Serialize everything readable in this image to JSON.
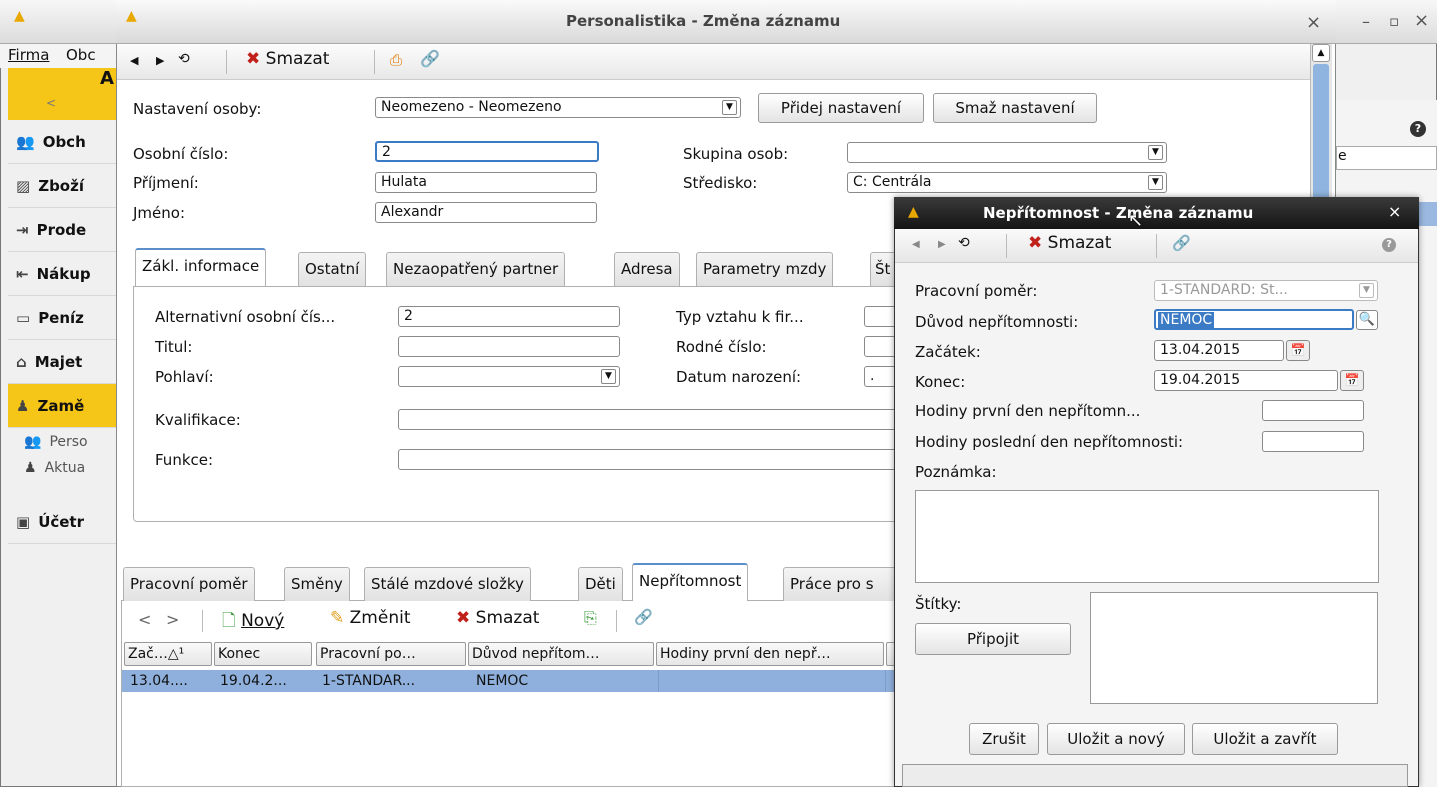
{
  "bg_window": {
    "menu": [
      "Firma",
      "Obc"
    ],
    "top_letter": "A",
    "collapse_arrow": "<",
    "nav": [
      {
        "icon": "people-icon",
        "label": "Obch"
      },
      {
        "icon": "box-icon",
        "label": "Zboží"
      },
      {
        "icon": "enter-icon",
        "label": "Prode"
      },
      {
        "icon": "exit-icon",
        "label": "Nákup"
      },
      {
        "icon": "money-icon",
        "label": "Peníz"
      },
      {
        "icon": "house-car-icon",
        "label": "Majet"
      },
      {
        "icon": "person-icon",
        "label": "Zamě"
      }
    ],
    "subnav": [
      {
        "icon": "people-icon",
        "label": "Perso"
      },
      {
        "icon": "person-card-icon",
        "label": "Aktua"
      }
    ],
    "nav_last": {
      "icon": "ledger-icon",
      "label": "Účetr"
    },
    "right_fragment": "e",
    "ctrl": {
      "min": "–",
      "max": "▫",
      "close": "×"
    }
  },
  "main_window": {
    "title": "Personalistika - Změna záznamu",
    "close": "×",
    "toolbar": {
      "delete": "Smazat"
    },
    "person_settings": {
      "label": "Nastavení osoby:",
      "value": "Neomezeno - Neomezeno",
      "add": "Přidej nastavení",
      "remove": "Smaž nastavení"
    },
    "personal_number": {
      "label": "Osobní číslo:",
      "value": "2"
    },
    "surname": {
      "label": "Příjmení:",
      "value": "Hulata"
    },
    "first_name": {
      "label": "Jméno:",
      "value": "Alexandr"
    },
    "group": {
      "label": "Skupina osob:",
      "value": ""
    },
    "center": {
      "label": "Středisko:",
      "value": "C: Centrála"
    },
    "tabs": [
      "Zákl. informace",
      "Ostatní",
      "Nezaopatřený partner",
      "Adresa",
      "Parametry mzdy",
      "Št"
    ],
    "basic": {
      "alt_number": {
        "label": "Alternativní osobní čís...",
        "value": "2"
      },
      "title": {
        "label": "Titul:",
        "value": ""
      },
      "sex": {
        "label": "Pohlaví:",
        "value": ""
      },
      "qualification": {
        "label": "Kvalifikace:",
        "value": ""
      },
      "function": {
        "label": "Funkce:",
        "value": ""
      },
      "relation": {
        "label": "Typ vztahu k fir..."
      },
      "birth_number": {
        "label": "Rodné číslo:"
      },
      "birth_date": {
        "label": "Datum narození:",
        "value": "."
      }
    },
    "lower_tabs": [
      "Pracovní poměr",
      "Směny",
      "Stálé mzdové složky",
      "Děti",
      "Nepřítomnost",
      "Práce pro s"
    ],
    "lower_toolbar": {
      "new": "Nový",
      "edit": "Změnit",
      "delete": "Smazat"
    },
    "table": {
      "headers": [
        "Zač…△¹",
        "Konec",
        "Pracovní po…",
        "Důvod nepřítom…",
        "Hodiny první den nepř…"
      ],
      "rows": [
        [
          "13.04....",
          "19.04.2...",
          "1-STANDAR...",
          "NEMOC",
          ""
        ]
      ]
    }
  },
  "dialog": {
    "title": "Nepřítomnost - Změna záznamu",
    "close": "×",
    "toolbar": {
      "delete": "Smazat"
    },
    "employment": {
      "label": "Pracovní poměr:",
      "value": "1-STANDARD: St..."
    },
    "reason": {
      "label": "Důvod nepřítomnosti:",
      "value": "NEMOC"
    },
    "start": {
      "label": "Začátek:",
      "value": "13.04.2015"
    },
    "end": {
      "label": "Konec:",
      "value": "19.04.2015"
    },
    "hours_first": {
      "label": "Hodiny první den nepřítomn...",
      "value": ""
    },
    "hours_last": {
      "label": "Hodiny poslední den nepřítomnosti:",
      "value": ""
    },
    "note": {
      "label": "Poznámka:",
      "value": ""
    },
    "tags": {
      "label": "Štítky:",
      "attach": "Připojit"
    },
    "buttons": {
      "cancel": "Zrušit",
      "save_new": "Uložit a nový",
      "save_close": "Uložit a zavřít"
    }
  }
}
